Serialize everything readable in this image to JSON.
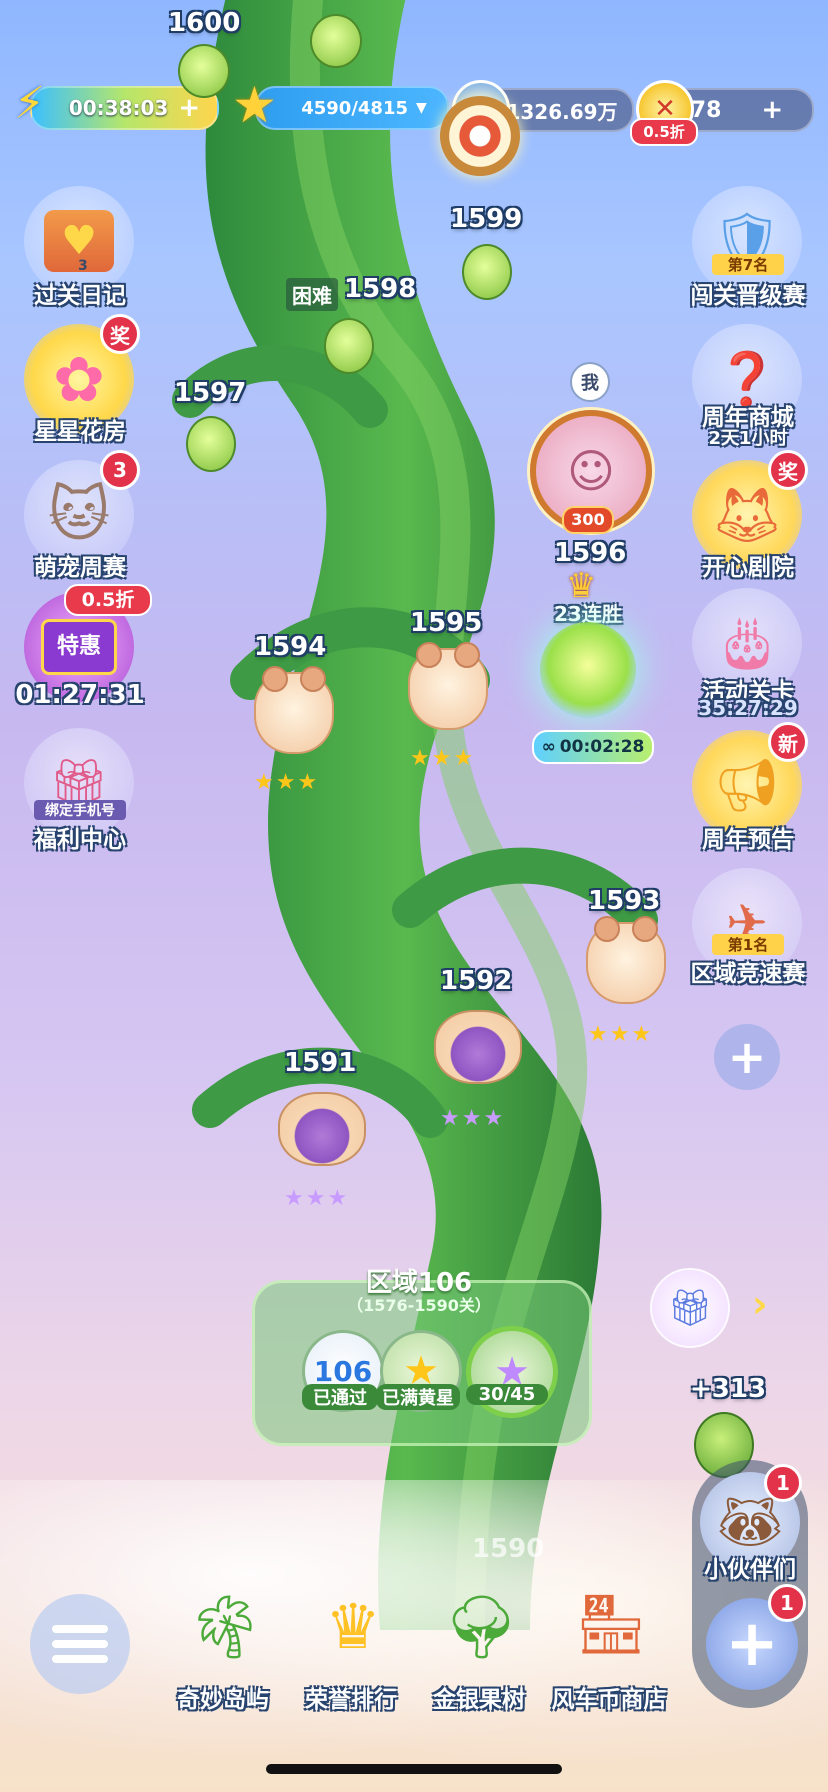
{
  "top_bar": {
    "energy_timer": "00:38:03",
    "stars": "4590/4815",
    "coins": "1326.69万",
    "gold": "78",
    "gold_discount": "0.5折"
  },
  "map": {
    "levels": [
      {
        "num": "1600"
      },
      {
        "num": "1599"
      },
      {
        "num": "1598",
        "tag": "困难"
      },
      {
        "num": "1597"
      },
      {
        "num": "1596"
      },
      {
        "num": "1595"
      },
      {
        "num": "1594"
      },
      {
        "num": "1593"
      },
      {
        "num": "1592"
      },
      {
        "num": "1591"
      },
      {
        "num": "1590"
      }
    ],
    "me_label": "我",
    "avatar_score": "300",
    "streak": "23连胜",
    "current_timer": "00:02:28",
    "plus_reward": "+313"
  },
  "left_menu": {
    "diary": {
      "label": "过关日记",
      "count": "3"
    },
    "flower_house": {
      "label": "星星花房",
      "badge": "奖"
    },
    "pet_week": {
      "label": "萌宠周赛",
      "badge": "3"
    },
    "special": {
      "label": "特惠",
      "discount": "0.5折",
      "timer": "01:27:31"
    },
    "welfare": {
      "label": "福利中心",
      "sub": "绑定手机号"
    }
  },
  "right_menu": {
    "rank_race": {
      "label": "闯关晋级赛",
      "rank": "第7名"
    },
    "anniversary_shop": {
      "label": "周年商城",
      "sub": "2天1小时"
    },
    "theater": {
      "label": "开心剧院",
      "badge": "奖"
    },
    "event_level": {
      "label": "活动关卡",
      "sub": "35:27:29"
    },
    "anniversary_preview": {
      "label": "周年预告",
      "badge": "新"
    },
    "region_race": {
      "label": "区域竞速赛",
      "rank": "第1名"
    }
  },
  "region_panel": {
    "title": "区域106",
    "range": "（1576-1590关）",
    "passed_value": "106",
    "passed_label": "已通过",
    "yellow_label": "已满黄星",
    "star_progress": "30/45"
  },
  "partners": {
    "label": "小伙伴们",
    "badge": "1",
    "plus_badge": "1"
  },
  "bottom_nav": [
    {
      "label": "奇妙岛屿"
    },
    {
      "label": "荣誉排行"
    },
    {
      "label": "金银果树"
    },
    {
      "label": "风车币商店"
    }
  ]
}
